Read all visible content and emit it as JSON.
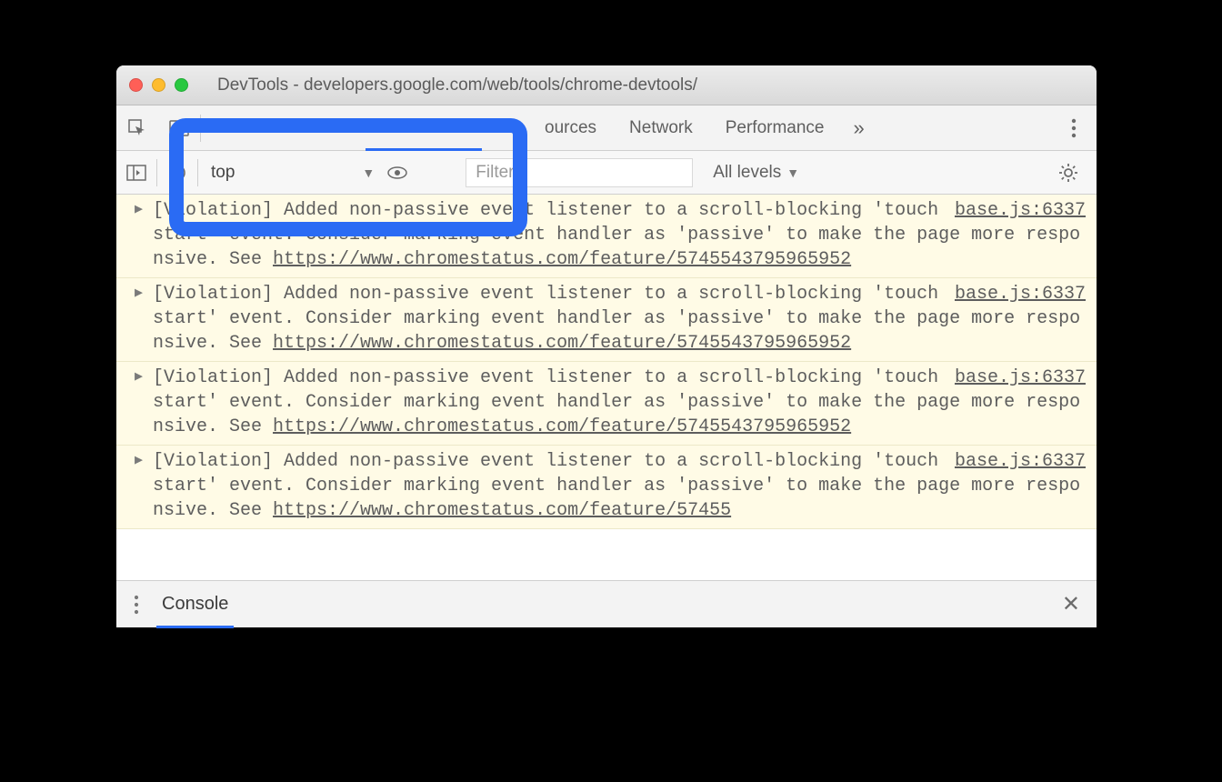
{
  "window": {
    "title": "DevTools - developers.google.com/web/tools/chrome-devtools/"
  },
  "toolbar": {
    "tabs": {
      "sources": "ources",
      "network": "Network",
      "performance": "Performance"
    },
    "more": "»"
  },
  "consolebar": {
    "context": "top",
    "filter_placeholder": "Filter",
    "levels_label": "All levels"
  },
  "messages": [
    {
      "pre": "[Violation] Added non-passive event listener to a scroll-blocking 'touchstart' event. Consider marking event handler as 'passive' to make the page more responsive. See ",
      "link": "https://www.chromestatus.com/feature/5745543795965952",
      "source": "base.js:6337"
    },
    {
      "pre": "[Violation] Added non-passive event listener to a scroll-blocking 'touchstart' event. Consider marking event handler as 'passive' to make the page more responsive. See ",
      "link": "https://www.chromestatus.com/feature/5745543795965952",
      "source": "base.js:6337"
    },
    {
      "pre": "[Violation] Added non-passive event listener to a scroll-blocking 'touchstart' event. Consider marking event handler as 'passive' to make the page more responsive. See ",
      "link": "https://www.chromestatus.com/feature/5745543795965952",
      "source": "base.js:6337"
    },
    {
      "pre": "[Violation] Added non-passive event listener to a scroll-blocking 'touchstart' event. Consider marking event handler as 'passive' to make the page more responsive. See ",
      "link": "https://www.chromestatus.com/feature/57455",
      "source": "base.js:6337"
    }
  ],
  "drawer": {
    "tab": "Console"
  }
}
